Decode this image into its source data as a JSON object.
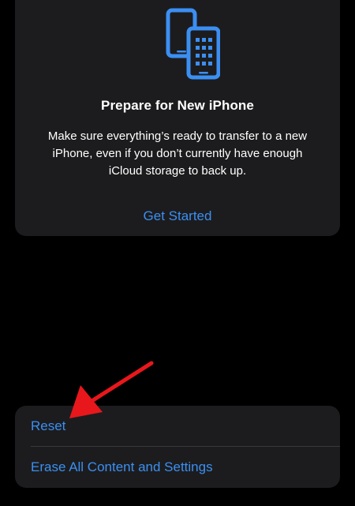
{
  "prepare_card": {
    "icon": "transfer-phones-icon",
    "title": "Prepare for New iPhone",
    "description": "Make sure everything’s ready to transfer to a new iPhone, even if you don’t currently have enough iCloud storage to back up.",
    "action_label": "Get Started"
  },
  "reset_section": {
    "items": [
      {
        "label": "Reset"
      },
      {
        "label": "Erase All Content and Settings"
      }
    ]
  },
  "annotation": {
    "icon": "red-arrow-icon",
    "color": "#e8171c"
  },
  "colors": {
    "background": "#000000",
    "card": "#1c1c1e",
    "accent": "#3b8ff2",
    "text": "#ffffff"
  }
}
